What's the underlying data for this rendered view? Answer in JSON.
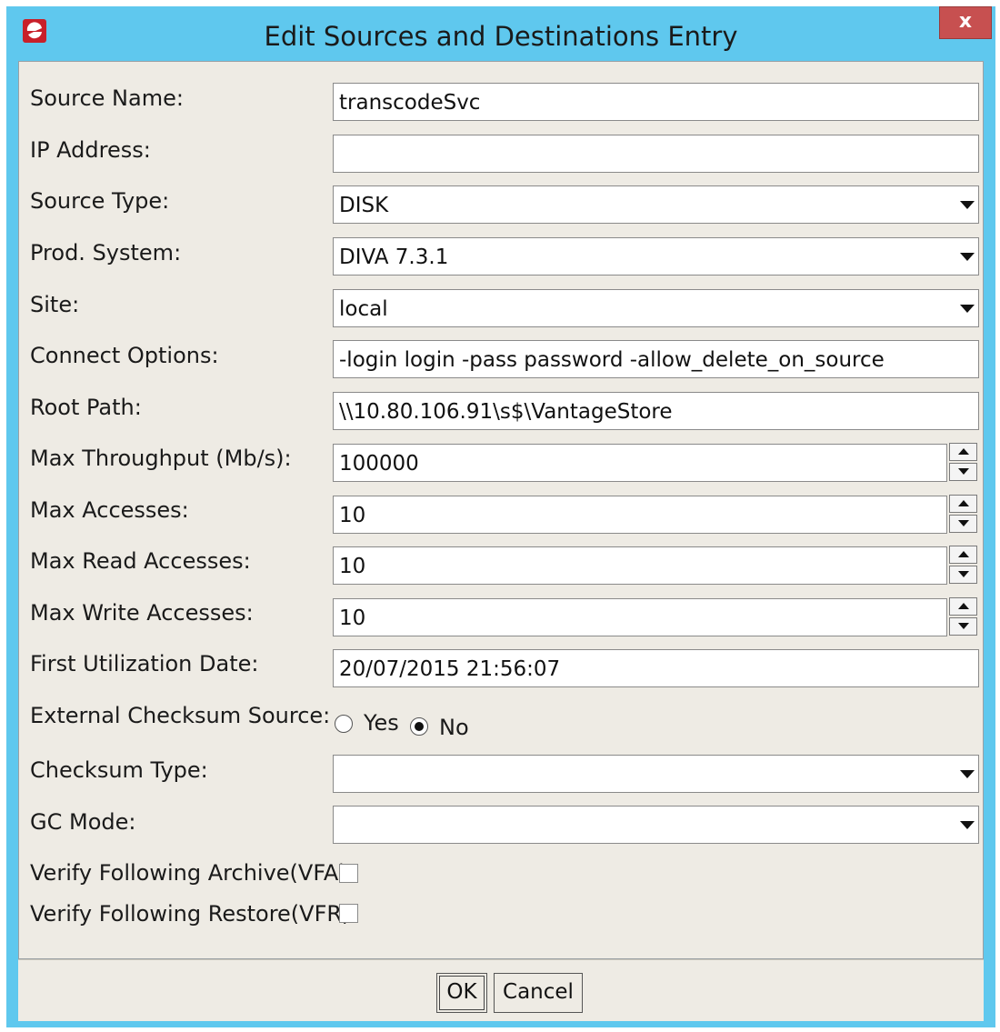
{
  "window": {
    "title": "Edit Sources and Destinations Entry",
    "close_label": "x",
    "colors": {
      "titlebar": "#5fc8ee",
      "close": "#c75050",
      "panel": "#eeebe4",
      "app_icon": "#c8202a"
    }
  },
  "fields": {
    "source_name": {
      "label": "Source Name:",
      "value": "transcodeSvc"
    },
    "ip_address": {
      "label": "IP Address:",
      "value": ""
    },
    "source_type": {
      "label": "Source Type:",
      "value": "DISK"
    },
    "prod_system": {
      "label": "Prod. System:",
      "value": "DIVA 7.3.1"
    },
    "site": {
      "label": "Site:",
      "value": "local"
    },
    "connect_options": {
      "label": "Connect Options:",
      "value": "-login login -pass password -allow_delete_on_source"
    },
    "root_path": {
      "label": "Root Path:",
      "value": "\\\\10.80.106.91\\s$\\VantageStore"
    },
    "max_throughput": {
      "label": "Max Throughput (Mb/s):",
      "value": "100000"
    },
    "max_accesses": {
      "label": "Max Accesses:",
      "value": "10"
    },
    "max_read_accesses": {
      "label": "Max Read Accesses:",
      "value": "10"
    },
    "max_write_accesses": {
      "label": "Max Write Accesses:",
      "value": "10"
    },
    "first_utilization_date": {
      "label": "First Utilization Date:",
      "value": "20/07/2015 21:56:07"
    },
    "external_checksum_source": {
      "label": "External Checksum Source:",
      "yes_label": "Yes",
      "no_label": "No",
      "selected": "No"
    },
    "checksum_type": {
      "label": "Checksum Type:",
      "value": ""
    },
    "gc_mode": {
      "label": "GC Mode:",
      "value": ""
    },
    "verify_following_archive": {
      "label": "Verify Following Archive(VFA):",
      "checked": false
    },
    "verify_following_restore": {
      "label": "Verify Following Restore(VFR):",
      "checked": false
    }
  },
  "buttons": {
    "ok_label": "OK",
    "cancel_label": "Cancel"
  }
}
